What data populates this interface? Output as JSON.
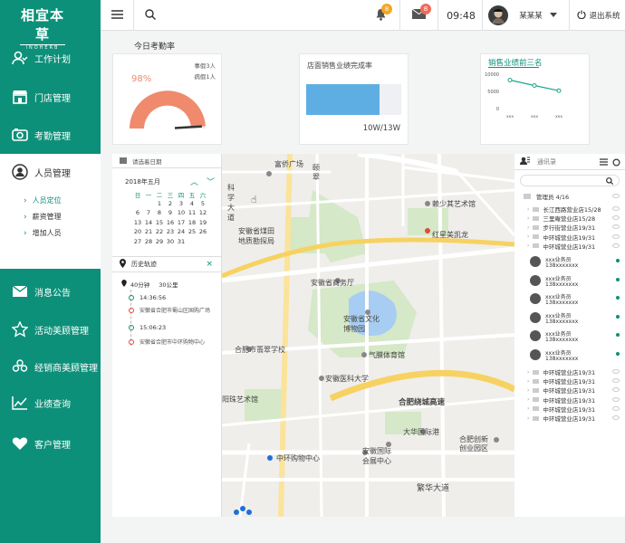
{
  "logo": {
    "title": "相宜本草",
    "subtitle": "INOHERB"
  },
  "sidebar": {
    "items": [
      {
        "label": "工作计划",
        "icon": "users-icon"
      },
      {
        "label": "门店管理",
        "icon": "store-icon"
      },
      {
        "label": "考勤管理",
        "icon": "attendance-icon"
      },
      {
        "label": "人员管理",
        "icon": "user-icon"
      },
      {
        "label": "消息公告",
        "icon": "mail-icon"
      },
      {
        "label": "活动美顾管理",
        "icon": "star-icon"
      },
      {
        "label": "经销商美顾管理",
        "icon": "group-icon"
      },
      {
        "label": "业绩查询",
        "icon": "chart-icon"
      },
      {
        "label": "客户管理",
        "icon": "heart-icon"
      }
    ],
    "submenu": [
      "人员定位",
      "薪资管理",
      "增加人员"
    ]
  },
  "topbar": {
    "bell_badge": "8",
    "mail_badge": "8",
    "time": "09:48",
    "username": "某某某",
    "logout": "退出系统"
  },
  "attendance": {
    "title": "今日考勤率",
    "rate": "98%",
    "rate_value": 0.98,
    "leave": "事假3人",
    "sick": "病假1人",
    "color": "#f08a6c"
  },
  "sales": {
    "title": "店面销售业绩完成率",
    "value": "10W/13W",
    "fraction": 0.77,
    "color": "#5faee3"
  },
  "top3": {
    "title": "销售业绩前三名",
    "chart_data": {
      "type": "line",
      "title": "销售业绩前三名",
      "categories": [
        "xxx",
        "xxx",
        "xxx"
      ],
      "values": [
        8300,
        6700,
        5200
      ],
      "yticks": [
        "10000",
        "5000",
        "0"
      ],
      "ylim": [
        0,
        10000
      ]
    }
  },
  "calendar": {
    "select_label": "请选着日期",
    "month": "2018年五月",
    "weekdays": [
      "日",
      "一",
      "二",
      "三",
      "四",
      "五",
      "六"
    ],
    "rows": [
      [
        "",
        "",
        "1",
        "2",
        "3",
        "4",
        "5"
      ],
      [
        "6",
        "7",
        "8",
        "9",
        "10",
        "11",
        "12"
      ],
      [
        "13",
        "14",
        "15",
        "16",
        "17",
        "18",
        "19"
      ],
      [
        "20",
        "21",
        "22",
        "23",
        "24",
        "25",
        "26"
      ],
      [
        "27",
        "28",
        "29",
        "30",
        "31",
        "",
        ""
      ]
    ]
  },
  "history": {
    "title": "历史轨迹",
    "duration": "40分钟",
    "distance": "30公里",
    "entries": [
      {
        "time": "14:36:56",
        "place": "安徽省合肥市蜀山区国购广场"
      },
      {
        "time": "15:06:23",
        "place": "安徽省合肥市中环购物中心"
      }
    ]
  },
  "map": {
    "labels": [
      "富侨广场",
      "颐",
      "翠",
      "科",
      "学",
      "大",
      "道",
      "安徽省煤田",
      "地质勘探局",
      "赖少其艺术馆",
      "红星美凯龙",
      "安徽省商务厅",
      "安徽省文化",
      "博物园",
      "合肥市翡翠学校",
      "气膜体育馆",
      "安徽医科大学",
      "合肥绕城高速",
      "阳珠艺术馆",
      "大华国际港",
      "安徽国际",
      "会展中心",
      "中环购物中心",
      "合肥创新",
      "创业园区",
      "繁华大道"
    ]
  },
  "contacts": {
    "search_placeholder": "通讯录",
    "manager": "管理员 4/16",
    "stores_top": [
      "长江西路营业店15/28",
      "三里庵营业店15/28",
      "步行街营业店19/31",
      "中环城营业店19/31",
      "中环城营业店19/31"
    ],
    "members": [
      {
        "name": "xxx业务员",
        "phone": "138xxxxxxx"
      },
      {
        "name": "xxx业务员",
        "phone": "138xxxxxxx"
      },
      {
        "name": "xxx业务员",
        "phone": "138xxxxxxx"
      },
      {
        "name": "xxx业务员",
        "phone": "138xxxxxxx"
      },
      {
        "name": "xxx业务员",
        "phone": "138xxxxxxx"
      },
      {
        "name": "xxx业务员",
        "phone": "138xxxxxxx"
      }
    ],
    "stores_bottom": [
      "中环城营业店19/31",
      "中环城营业店19/31",
      "中环城营业店19/31",
      "中环城营业店19/31",
      "中环城营业店19/31",
      "中环城营业店19/31"
    ]
  }
}
